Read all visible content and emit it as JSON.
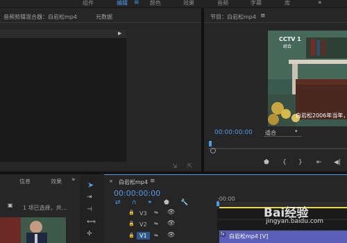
{
  "workspaces": [
    {
      "label": "组件",
      "active": false
    },
    {
      "label": "编辑",
      "active": true
    },
    {
      "label": "颜色",
      "active": false
    },
    {
      "label": "效果",
      "active": false
    },
    {
      "label": "音频",
      "active": false
    },
    {
      "label": "字幕",
      "active": false
    },
    {
      "label": "库",
      "active": false
    }
  ],
  "workspace_menu_icon": "hamburger-icon",
  "overflow_icon": "double-chevron-right-icon",
  "audio_mixer": {
    "tab_label": "音频剪辑混合器：白岩松mp4",
    "metadata_label": "元数据"
  },
  "program": {
    "title": "节目：白岩松mp4",
    "menu_icon": "hamburger-icon",
    "timecode": "00:00:00:00",
    "fit_label": "适合",
    "video": {
      "logo": "CCTV 1",
      "logo_sub": "综合",
      "caption": "白岩松2006年当年，"
    }
  },
  "project": {
    "info_tab": "信息",
    "effects_tab": "效果",
    "status": "1 项已选择，共..."
  },
  "timeline": {
    "title": "白岩松mp4",
    "menu_icon": "hamburger-icon",
    "timecode": "00:00:00:00",
    "ruler_start": ":00:00",
    "tracks": [
      {
        "name": "V3",
        "active": false
      },
      {
        "name": "V2",
        "active": false
      },
      {
        "name": "V1",
        "active": true
      }
    ],
    "clip_label": "白岩松mp4 [V]",
    "clip_badge": "fx"
  },
  "watermark": {
    "brand": "Bai经验",
    "url": "jingyan.baidu.com"
  }
}
